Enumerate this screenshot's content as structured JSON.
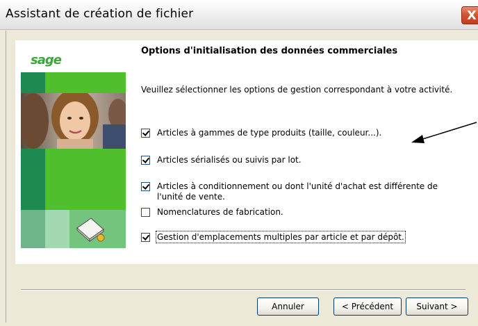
{
  "window": {
    "title": "Assistant de création de fichier",
    "close_label": "X"
  },
  "brand": {
    "logo_text": "sage",
    "green_dark": "#1f8a50",
    "green_light": "#4fbf2d"
  },
  "page": {
    "heading": "Options d'initialisation des données commerciales",
    "intro": "Veuillez sélectionner les options de gestion correspondant à votre activité."
  },
  "options": [
    {
      "label": "Articles à gammes de type produits (taille, couleur...).",
      "checked": true
    },
    {
      "label": "Articles sérialisés ou suivis par lot.",
      "checked": true
    },
    {
      "label": "Articles à conditionnement ou dont l'unité d'achat est différente de l'unité de vente.",
      "checked": true
    },
    {
      "label": "Nomenclatures de fabrication.",
      "checked": false
    },
    {
      "label": "Gestion d'emplacements multiples par article et par dépôt.",
      "checked": true
    }
  ],
  "buttons": {
    "cancel": "Annuler",
    "previous": "< Précédent",
    "next": "Suivant >"
  }
}
